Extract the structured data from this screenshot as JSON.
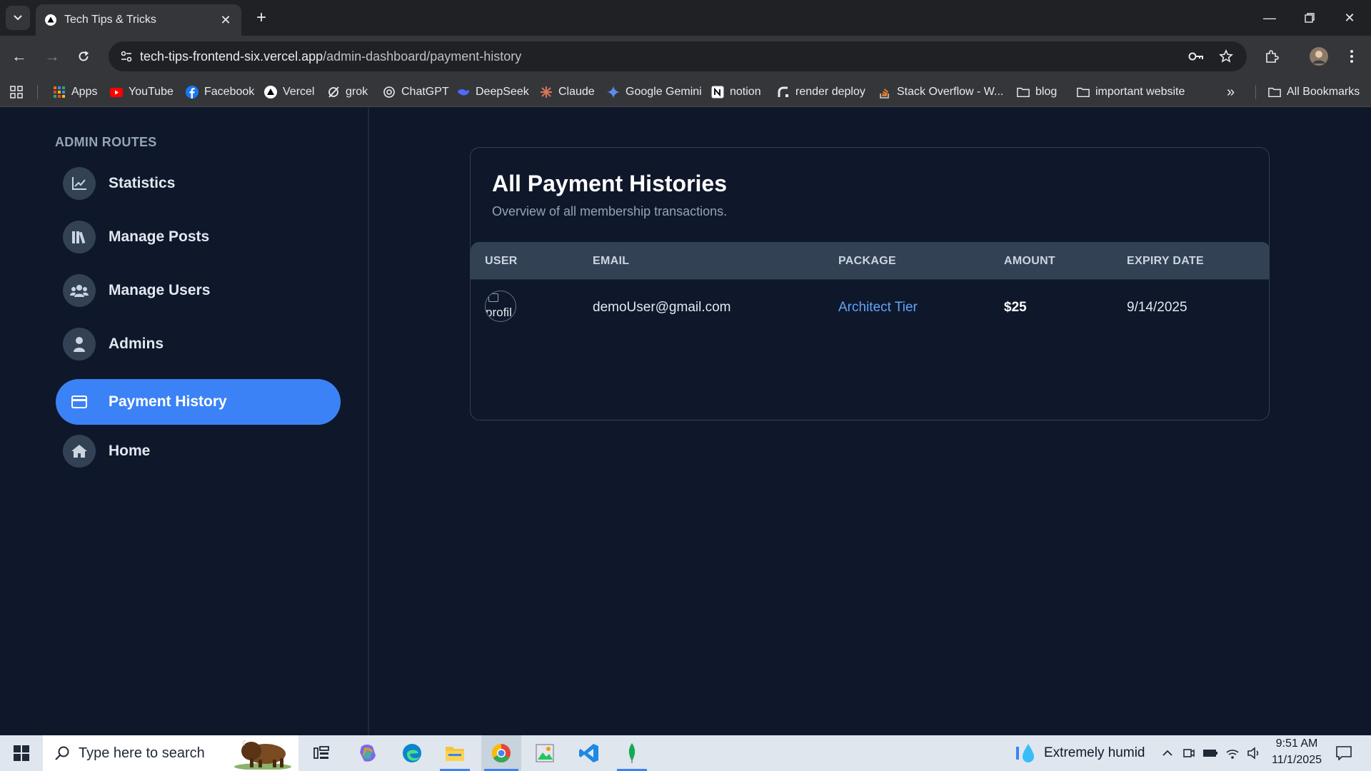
{
  "browser": {
    "tab_title": "Tech Tips & Tricks",
    "url_domain": "tech-tips-frontend-six.vercel.app",
    "url_path": "/admin-dashboard/payment-history",
    "bookmarks": [
      {
        "label": "Apps",
        "icon": "apps-grid-icon"
      },
      {
        "label": "YouTube",
        "icon": "youtube-icon"
      },
      {
        "label": "Facebook",
        "icon": "facebook-icon"
      },
      {
        "label": "Vercel",
        "icon": "vercel-icon"
      },
      {
        "label": "grok",
        "icon": "grok-icon"
      },
      {
        "label": "ChatGPT",
        "icon": "chatgpt-icon"
      },
      {
        "label": "DeepSeek",
        "icon": "deepseek-icon"
      },
      {
        "label": "Claude",
        "icon": "claude-icon"
      },
      {
        "label": "Google Gemini",
        "icon": "gemini-icon"
      },
      {
        "label": "notion",
        "icon": "notion-icon"
      },
      {
        "label": "render deploy",
        "icon": "render-icon"
      },
      {
        "label": "Stack Overflow - W...",
        "icon": "stackoverflow-icon"
      },
      {
        "label": "blog",
        "icon": "folder-icon"
      },
      {
        "label": "important website",
        "icon": "folder-icon"
      }
    ],
    "all_bookmarks": "All Bookmarks",
    "overflow": "»"
  },
  "sidebar": {
    "heading": "ADMIN ROUTES",
    "items": [
      {
        "label": "Statistics",
        "icon": "chart-line-icon",
        "active": false
      },
      {
        "label": "Manage Posts",
        "icon": "books-icon",
        "active": false
      },
      {
        "label": "Manage Users",
        "icon": "users-icon",
        "active": false
      },
      {
        "label": "Admins",
        "icon": "user-icon",
        "active": false
      },
      {
        "label": "Payment History",
        "icon": "credit-card-icon",
        "active": true
      },
      {
        "label": "Home",
        "icon": "home-icon",
        "active": false
      }
    ]
  },
  "main": {
    "title": "All Payment Histories",
    "subtitle": "Overview of all membership transactions.",
    "table": {
      "headers": [
        "USER",
        "EMAIL",
        "PACKAGE",
        "AMOUNT",
        "EXPIRY DATE"
      ],
      "rows": [
        {
          "avatar_alt": "profil",
          "email": "demoUser@gmail.com",
          "package": "Architect Tier",
          "amount": "$25",
          "expiry": "9/14/2025"
        }
      ]
    }
  },
  "taskbar": {
    "search_placeholder": "Type here to search",
    "weather": "Extremely humid",
    "time": "9:51 AM",
    "date": "11/1/2025"
  },
  "colors": {
    "page_bg": "#0f172a",
    "accent": "#3b82f6",
    "link": "#60a5fa"
  }
}
